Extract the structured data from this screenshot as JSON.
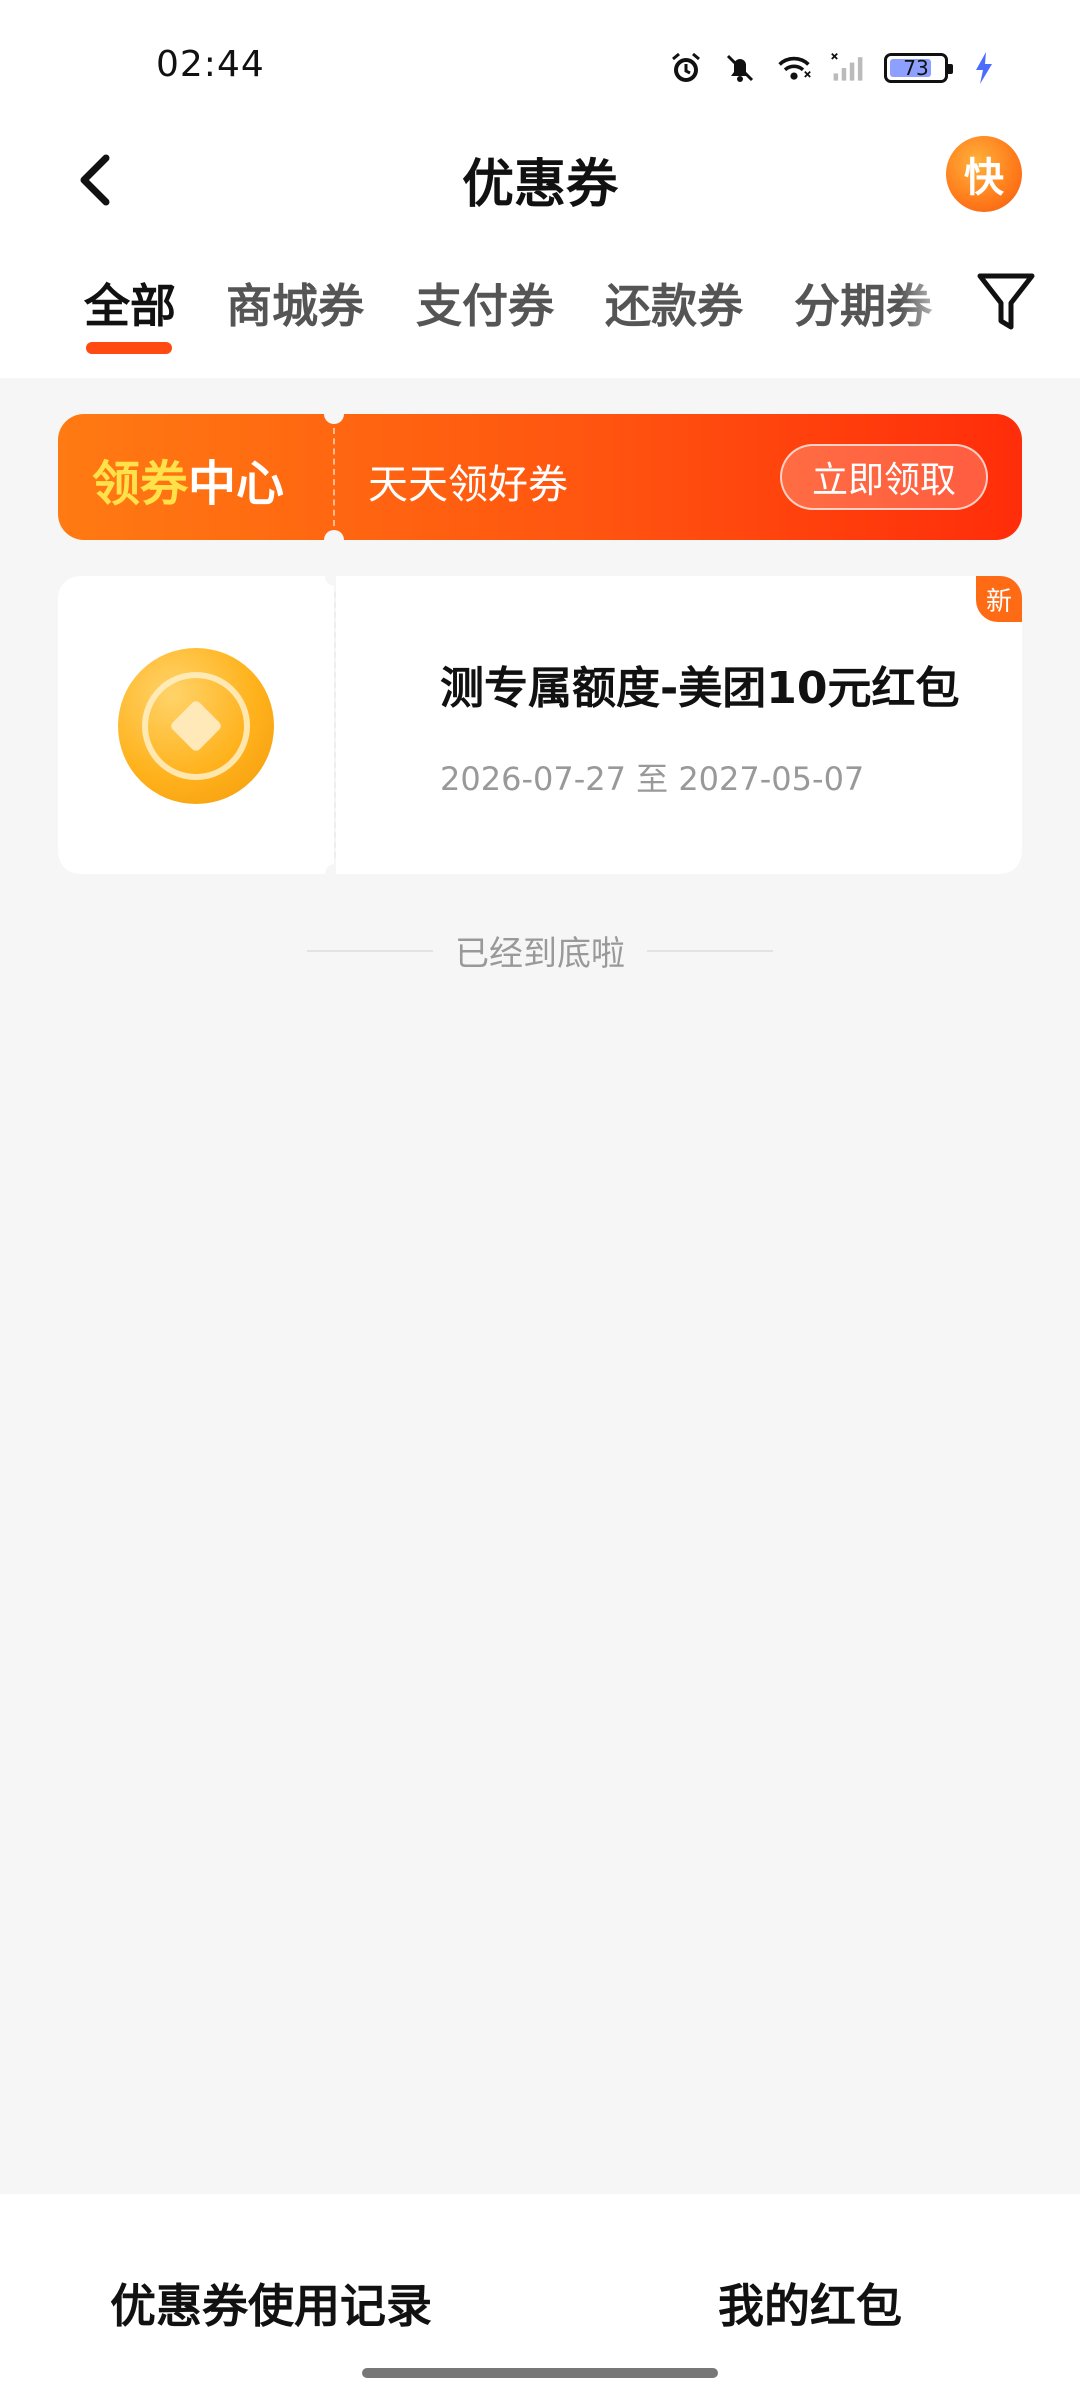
{
  "status_bar": {
    "time": "02:44",
    "battery_level": "73",
    "icons": [
      "alarm-icon",
      "bell-off-icon",
      "wifi-icon",
      "signal-icon",
      "battery-icon",
      "charging-icon"
    ]
  },
  "header": {
    "title": "优惠券",
    "quick_badge": "快"
  },
  "tabs": {
    "items": [
      {
        "label": "全部",
        "active": true
      },
      {
        "label": "商城券",
        "active": false
      },
      {
        "label": "支付券",
        "active": false
      },
      {
        "label": "还款券",
        "active": false
      },
      {
        "label": "分期券",
        "active": false
      }
    ]
  },
  "banner": {
    "logo_part1": "领券",
    "logo_part2": "中心",
    "subtitle": "天天领好券",
    "button": "立即领取"
  },
  "coupons": [
    {
      "title": "测专属额度-美团10元红包",
      "date": "2026-07-27 至 2027-05-07",
      "badge": "新",
      "icon": "coin-icon"
    }
  ],
  "end_text": "已经到底啦",
  "bottom": {
    "left": "优惠券使用记录",
    "right": "我的红包"
  },
  "colors": {
    "accent": "#ff4a12",
    "banner_start": "#ff7a12",
    "banner_end": "#ff2d0a",
    "coin": "#ffb21c"
  }
}
